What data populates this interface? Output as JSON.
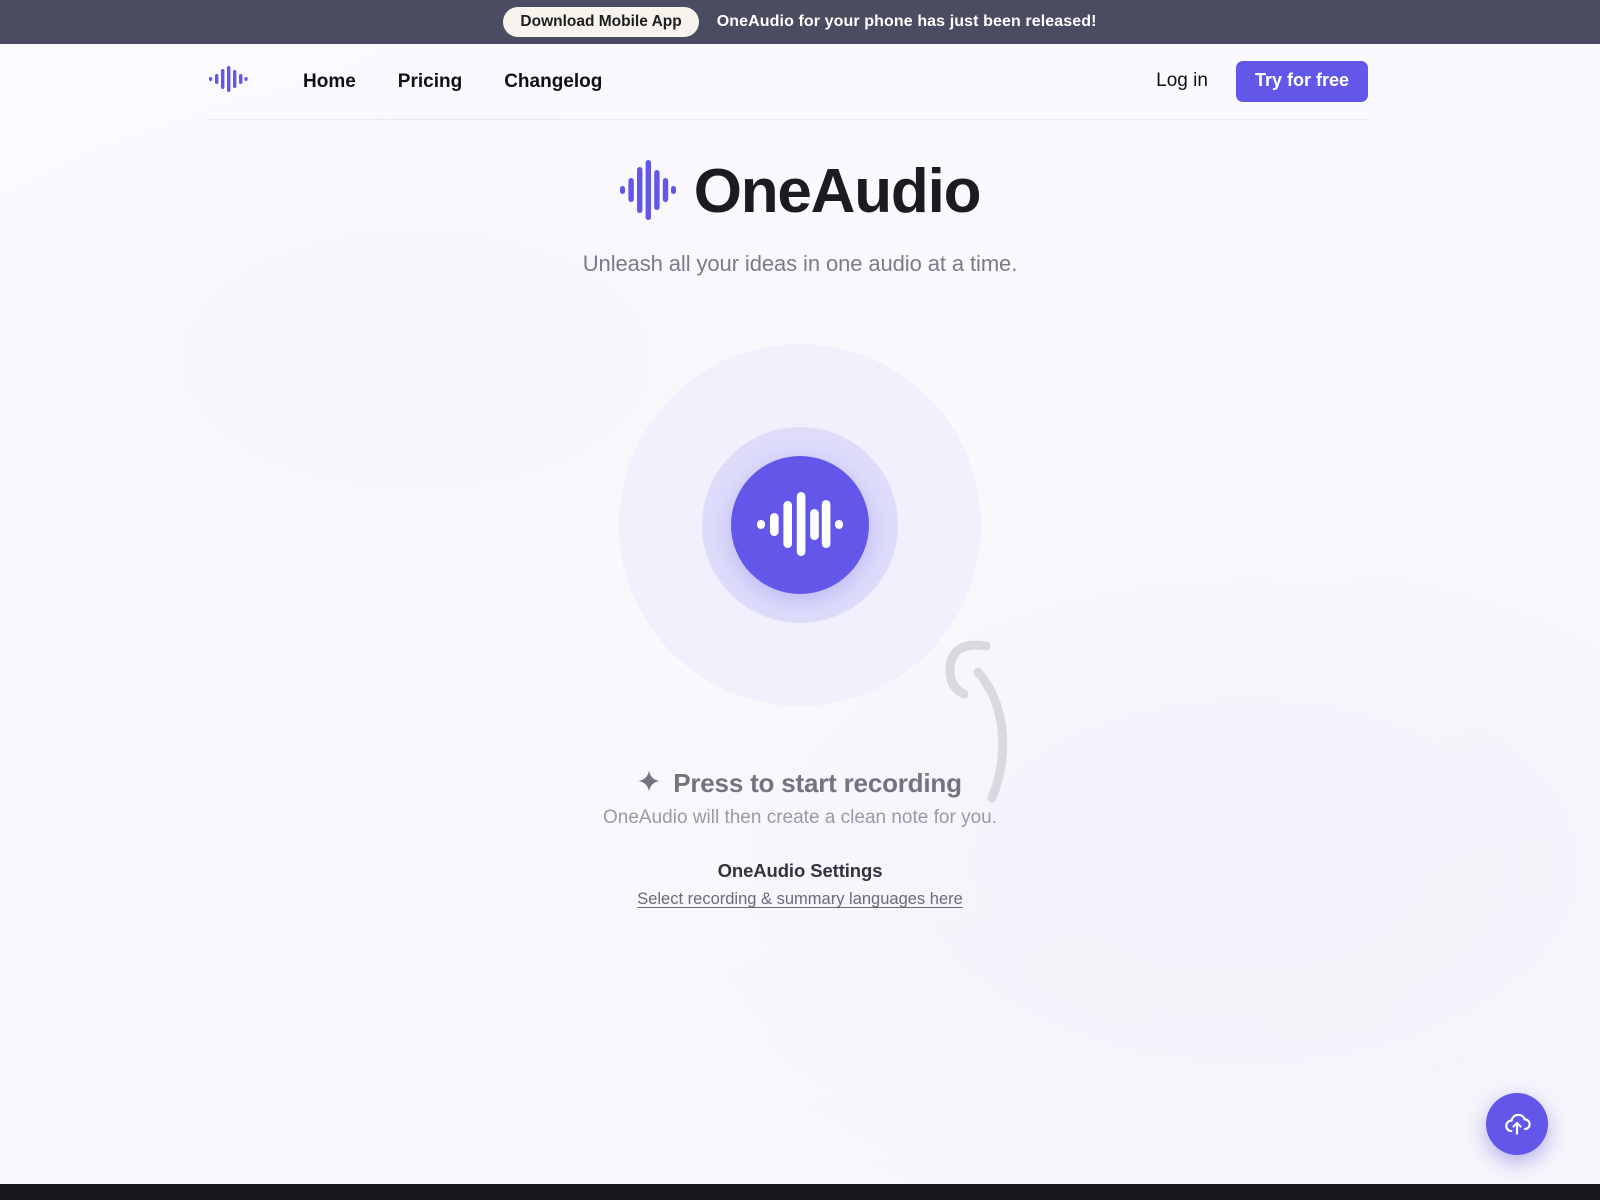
{
  "banner": {
    "button_label": "Download Mobile App",
    "message": "OneAudio for your phone has just been released!",
    "background_color": "#4b4b62"
  },
  "nav": {
    "logo_icon": "audio-waveform-logo-icon",
    "links": [
      {
        "label": "Home"
      },
      {
        "label": "Pricing"
      },
      {
        "label": "Changelog"
      }
    ],
    "login_label": "Log in",
    "cta_label": "Try for free",
    "accent_color": "#6257e8"
  },
  "hero": {
    "logo_icon": "audio-waveform-logo-icon",
    "title": "OneAudio",
    "subtitle": "Unleash all your ideas in one audio at a time."
  },
  "recorder": {
    "button_icon": "audio-waveform-record-icon",
    "accent_color": "#6257e8",
    "halo_mid_color": "#dedcfa",
    "halo_outer_color": "#f0effb",
    "prompt_icon": "sparkle-icon",
    "prompt_title": "Press to start recording",
    "prompt_subtitle": "OneAudio will then create a clean note for you.",
    "arrow_icon": "curved-arrow-icon"
  },
  "settings": {
    "title": "OneAudio Settings",
    "link_label": "Select recording & summary languages here"
  },
  "fab": {
    "icon": "cloud-upload-icon",
    "background_color": "#6257e8"
  }
}
